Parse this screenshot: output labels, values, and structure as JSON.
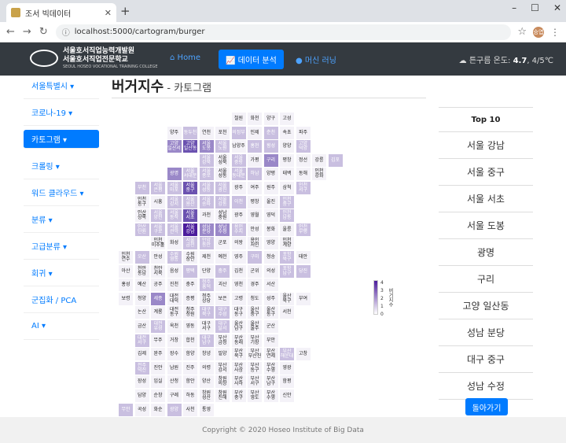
{
  "browser": {
    "tab_title": "조서 빅데이터",
    "url": "localhost:5000/cartogram/burger",
    "avatar_text": "승엽"
  },
  "header": {
    "logo_line1": "서울호서직업능력개발원",
    "logo_line2": "서울호서직업전문학교",
    "logo_sub": "SEOUL HOSEO VOCATIONAL TRAINING COLLEGE",
    "nav_home": "Home",
    "nav_analysis": "데이터 분석",
    "nav_ml": "머신 러닝",
    "weather_label": "튼구름 온도:",
    "weather_temp": "4.7",
    "weather_range": ", 4/5℃"
  },
  "sidebar": {
    "items": [
      {
        "label": "서울특별시 ▾"
      },
      {
        "label": "코로나-19 ▾"
      },
      {
        "label": "카토그램 ▾"
      },
      {
        "label": "크롤링 ▾"
      },
      {
        "label": "워드 클라우드 ▾"
      },
      {
        "label": "분류 ▾"
      },
      {
        "label": "고급분류 ▾"
      },
      {
        "label": "회귀 ▾"
      },
      {
        "label": "군집화 / PCA"
      },
      {
        "label": "AI ▾"
      }
    ]
  },
  "main": {
    "title": "버거지수",
    "subtitle": " - 카토그램"
  },
  "legend": {
    "max": "4",
    "mid1": "3",
    "mid2": "2",
    "mid3": "1",
    "min": "0",
    "title": "버거지수"
  },
  "top10": {
    "heading": "Top 10",
    "items": [
      "서울 강남",
      "서울 중구",
      "서울 서초",
      "서울 도봉",
      "광명",
      "구리",
      "고양 일산동",
      "성남 분당",
      "대구 중구",
      "성남 수정"
    ]
  },
  "back_button": "돌아가기",
  "footer": "Copyright © 2020 Hoseo Institute of Big Data",
  "map_cells": [
    {
      "t": "철원",
      "v": 0
    },
    {
      "t": "화천",
      "v": 0
    },
    {
      "t": "양구",
      "v": 0
    },
    {
      "t": "고성",
      "v": 0
    },
    {
      "t": "양주",
      "v": 0
    },
    {
      "t": "동두천",
      "v": 1
    },
    {
      "t": "연천",
      "v": 0
    },
    {
      "t": "포천",
      "v": 0
    },
    {
      "t": "의정부",
      "v": 1
    },
    {
      "t": "인제",
      "v": 0
    },
    {
      "t": "춘천",
      "v": 1
    },
    {
      "t": "속초",
      "v": 0
    },
    {
      "t": "파주",
      "v": 0
    },
    {
      "t": "고양 일산서",
      "v": 2
    },
    {
      "t": "고양 일산동",
      "v": 3
    },
    {
      "t": "서울 도봉",
      "v": 2
    },
    {
      "t": "서울 노원",
      "v": 1
    },
    {
      "t": "남양주",
      "v": 0
    },
    {
      "t": "홍천",
      "v": 1
    },
    {
      "t": "횡성",
      "v": 1
    },
    {
      "t": "양양",
      "v": 0
    },
    {
      "t": "고양 덕양",
      "v": 1
    },
    {
      "t": "서울 강북",
      "v": 1
    },
    {
      "t": "서울 성북",
      "v": 0
    },
    {
      "t": "서울 중랑",
      "v": 1
    },
    {
      "t": "가평",
      "v": 0
    },
    {
      "t": "구리",
      "v": 2
    },
    {
      "t": "평창",
      "v": 0
    },
    {
      "t": "정선",
      "v": 0
    },
    {
      "t": "강릉",
      "v": 0
    },
    {
      "t": "김포",
      "v": 1
    },
    {
      "t": "광명",
      "v": 2
    },
    {
      "t": "서울 서대문",
      "v": 1
    },
    {
      "t": "서울 종로",
      "v": 1
    },
    {
      "t": "서울 성동",
      "v": 0
    },
    {
      "t": "서울 동대문",
      "v": 1
    },
    {
      "t": "하남",
      "v": 1
    },
    {
      "t": "양평",
      "v": 0
    },
    {
      "t": "태백",
      "v": 0
    },
    {
      "t": "동해",
      "v": 0
    },
    {
      "t": "인천 강화",
      "v": 0
    },
    {
      "t": "부천",
      "v": 1
    },
    {
      "t": "서울 은평",
      "v": 1
    },
    {
      "t": "서울 마포",
      "v": 1
    },
    {
      "t": "서울 중구",
      "v": 3
    },
    {
      "t": "서울 성동",
      "v": 1
    },
    {
      "t": "서울 광진",
      "v": 1
    },
    {
      "t": "광주",
      "v": 0
    },
    {
      "t": "여주",
      "v": 0
    },
    {
      "t": "원주",
      "v": 0
    },
    {
      "t": "삼척",
      "v": 0
    },
    {
      "t": "인천 서구",
      "v": 1
    },
    {
      "t": "인천 동구",
      "v": 0
    },
    {
      "t": "시흥",
      "v": 0
    },
    {
      "t": "서울 강서",
      "v": 1
    },
    {
      "t": "서울 용산",
      "v": 1
    },
    {
      "t": "서울 송파",
      "v": 1
    },
    {
      "t": "서울 강동",
      "v": 1
    },
    {
      "t": "이천",
      "v": 1
    },
    {
      "t": "평창",
      "v": 0
    },
    {
      "t": "울진",
      "v": 0
    },
    {
      "t": "인천 중구",
      "v": 1
    },
    {
      "t": "인산 상록",
      "v": 0
    },
    {
      "t": "서울 양천",
      "v": 1
    },
    {
      "t": "서울 동작",
      "v": 1
    },
    {
      "t": "서울 서초",
      "v": 3
    },
    {
      "t": "과천",
      "v": 0
    },
    {
      "t": "성남 중원",
      "v": 0
    },
    {
      "t": "광주",
      "v": 0
    },
    {
      "t": "영월",
      "v": 0
    },
    {
      "t": "영덕",
      "v": 0
    },
    {
      "t": "인천 남동",
      "v": 1
    },
    {
      "t": "안산 단원",
      "v": 1
    },
    {
      "t": "서울 구로",
      "v": 1
    },
    {
      "t": "서울 관악",
      "v": 1
    },
    {
      "t": "서울 강남",
      "v": 4
    },
    {
      "t": "성남 분당",
      "v": 2
    },
    {
      "t": "성남 수정",
      "v": 2
    },
    {
      "t": "용인 수지",
      "v": 1
    },
    {
      "t": "안성",
      "v": 0
    },
    {
      "t": "봉화",
      "v": 0
    },
    {
      "t": "울릉",
      "v": 0
    },
    {
      "t": "인천 부평",
      "v": 1
    },
    {
      "t": "인천 미추홀",
      "v": 0
    },
    {
      "t": "화성",
      "v": 0
    },
    {
      "t": "서울 금천",
      "v": 1
    },
    {
      "t": "안양 동안",
      "v": 1
    },
    {
      "t": "군포",
      "v": 0
    },
    {
      "t": "의왕",
      "v": 0
    },
    {
      "t": "용인 처인",
      "v": 0
    },
    {
      "t": "영양",
      "v": 0
    },
    {
      "t": "인천 계양",
      "v": 0
    },
    {
      "t": "인천 연수",
      "v": 0
    },
    {
      "t": "오산",
      "v": 1
    },
    {
      "t": "안성",
      "v": 0
    },
    {
      "t": "수원 영통",
      "v": 1
    },
    {
      "t": "수원 장안",
      "v": 0
    },
    {
      "t": "제천",
      "v": 0
    },
    {
      "t": "예천",
      "v": 0
    },
    {
      "t": "영주",
      "v": 0
    },
    {
      "t": "구미",
      "v": 1
    },
    {
      "t": "청송",
      "v": 0
    },
    {
      "t": "포항 북구",
      "v": 1
    },
    {
      "t": "태안",
      "v": 0
    },
    {
      "t": "아산",
      "v": 0
    },
    {
      "t": "천안 동남",
      "v": 0
    },
    {
      "t": "천안 서북",
      "v": 0
    },
    {
      "t": "음성",
      "v": 0
    },
    {
      "t": "평택",
      "v": 1
    },
    {
      "t": "단양",
      "v": 0
    },
    {
      "t": "충주",
      "v": 1
    },
    {
      "t": "김천",
      "v": 0
    },
    {
      "t": "군위",
      "v": 0
    },
    {
      "t": "의성",
      "v": 0
    },
    {
      "t": "포항 남구",
      "v": 1
    },
    {
      "t": "당진",
      "v": 1
    },
    {
      "t": "홍성",
      "v": 0
    },
    {
      "t": "예산",
      "v": 0
    },
    {
      "t": "공주",
      "v": 0
    },
    {
      "t": "진천",
      "v": 0
    },
    {
      "t": "충주",
      "v": 0
    },
    {
      "t": "청주 흥덕",
      "v": 1
    },
    {
      "t": "괴산",
      "v": 0
    },
    {
      "t": "영천",
      "v": 0
    },
    {
      "t": "경주",
      "v": 0
    },
    {
      "t": "서산",
      "v": 0
    },
    {
      "t": "보령",
      "v": 0
    },
    {
      "t": "청양",
      "v": 0
    },
    {
      "t": "세종",
      "v": 2
    },
    {
      "t": "대전 대덕",
      "v": 0
    },
    {
      "t": "증평",
      "v": 0
    },
    {
      "t": "청주 상당",
      "v": 0
    },
    {
      "t": "보은",
      "v": 0
    },
    {
      "t": "고령",
      "v": 0
    },
    {
      "t": "청도",
      "v": 0
    },
    {
      "t": "성주",
      "v": 0
    },
    {
      "t": "울산 북구",
      "v": 0
    },
    {
      "t": "부여",
      "v": 0
    },
    {
      "t": "논산",
      "v": 0
    },
    {
      "t": "계룡",
      "v": 0
    },
    {
      "t": "대전 동구",
      "v": 0
    },
    {
      "t": "청주 청원",
      "v": 0
    },
    {
      "t": "대구 북구",
      "v": 1
    },
    {
      "t": "대구 수성",
      "v": 1
    },
    {
      "t": "대구 동구",
      "v": 0
    },
    {
      "t": "울산 중구",
      "v": 0
    },
    {
      "t": "울산 동구",
      "v": 0
    },
    {
      "t": "서천",
      "v": 0
    },
    {
      "t": "금산",
      "v": 0
    },
    {
      "t": "대전 유성",
      "v": 1
    },
    {
      "t": "옥천",
      "v": 0
    },
    {
      "t": "영동",
      "v": 0
    },
    {
      "t": "대구 서구",
      "v": 0
    },
    {
      "t": "대구 달서",
      "v": 1
    },
    {
      "t": "울산 남구",
      "v": 0
    },
    {
      "t": "울산 울주",
      "v": 0
    },
    {
      "t": "군산",
      "v": 0
    },
    {
      "t": "대전 서구",
      "v": 1
    },
    {
      "t": "무주",
      "v": 0
    },
    {
      "t": "거창",
      "v": 0
    },
    {
      "t": "합천",
      "v": 0
    },
    {
      "t": "대구 남구",
      "v": 1
    },
    {
      "t": "부산 금정",
      "v": 0
    },
    {
      "t": "부산 동래",
      "v": 0
    },
    {
      "t": "부산 기장",
      "v": 0
    },
    {
      "t": "부안",
      "v": 0
    },
    {
      "t": "김제",
      "v": 0
    },
    {
      "t": "완주",
      "v": 0
    },
    {
      "t": "장수",
      "v": 0
    },
    {
      "t": "함양",
      "v": 0
    },
    {
      "t": "창녕",
      "v": 0
    },
    {
      "t": "밀양",
      "v": 0
    },
    {
      "t": "부산 북구",
      "v": 0
    },
    {
      "t": "부산 부산진",
      "v": 0
    },
    {
      "t": "부산 연제",
      "v": 0
    },
    {
      "t": "부산 해운대",
      "v": 1
    },
    {
      "t": "고창",
      "v": 0
    },
    {
      "t": "전주 덕진",
      "v": 1
    },
    {
      "t": "진안",
      "v": 0
    },
    {
      "t": "남원",
      "v": 0
    },
    {
      "t": "진주",
      "v": 0
    },
    {
      "t": "의령",
      "v": 0
    },
    {
      "t": "부산 강서",
      "v": 0
    },
    {
      "t": "부산 사상",
      "v": 0
    },
    {
      "t": "부산 동구",
      "v": 0
    },
    {
      "t": "부산 수영",
      "v": 0
    },
    {
      "t": "영광",
      "v": 0
    },
    {
      "t": "장성",
      "v": 0
    },
    {
      "t": "임실",
      "v": 0
    },
    {
      "t": "산청",
      "v": 0
    },
    {
      "t": "함안",
      "v": 0
    },
    {
      "t": "양산",
      "v": 0
    },
    {
      "t": "창원 의창",
      "v": 0
    },
    {
      "t": "부산 사하",
      "v": 0
    },
    {
      "t": "부산 서구",
      "v": 0
    },
    {
      "t": "부산 남구",
      "v": 0
    },
    {
      "t": "함평",
      "v": 0
    },
    {
      "t": "담양",
      "v": 0
    },
    {
      "t": "순창",
      "v": 0
    },
    {
      "t": "구례",
      "v": 0
    },
    {
      "t": "하동",
      "v": 0
    },
    {
      "t": "창원 성산",
      "v": 0
    },
    {
      "t": "창원 진해",
      "v": 0
    },
    {
      "t": "부산 중구",
      "v": 0
    },
    {
      "t": "부산 영도",
      "v": 0
    },
    {
      "t": "부산 수영",
      "v": 0
    },
    {
      "t": "신안",
      "v": 0
    },
    {
      "t": "무안",
      "v": 1
    },
    {
      "t": "곡성",
      "v": 0
    },
    {
      "t": "화순",
      "v": 0
    },
    {
      "t": "광양",
      "v": 1
    },
    {
      "t": "사천",
      "v": 0
    },
    {
      "t": "통영",
      "v": 0
    }
  ]
}
